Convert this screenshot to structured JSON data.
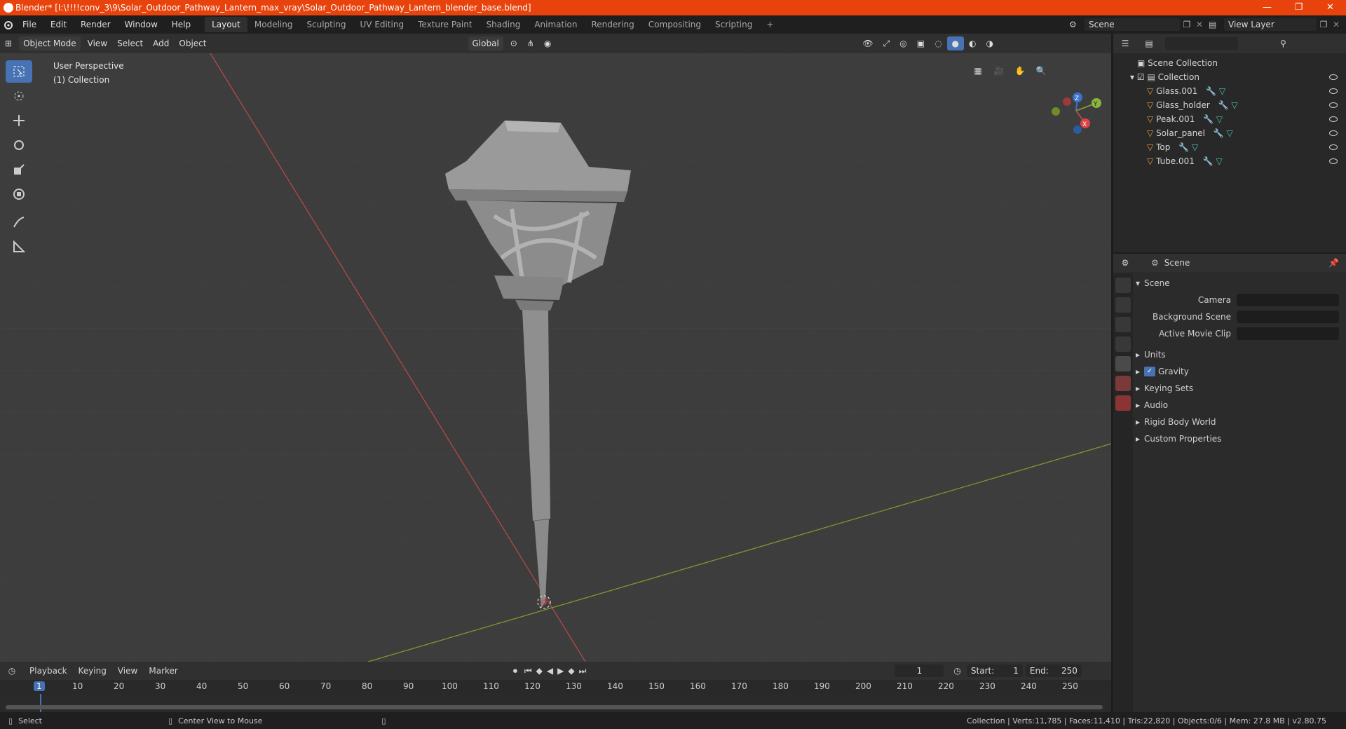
{
  "window": {
    "title": "Blender* [I:\\!!!!conv_3\\9\\Solar_Outdoor_Pathway_Lantern_max_vray\\Solar_Outdoor_Pathway_Lantern_blender_base.blend]",
    "minimize": "—",
    "maximize": "❐",
    "close": "✕"
  },
  "menu": [
    "File",
    "Edit",
    "Render",
    "Window",
    "Help"
  ],
  "workspaces": [
    "Layout",
    "Modeling",
    "Sculpting",
    "UV Editing",
    "Texture Paint",
    "Shading",
    "Animation",
    "Rendering",
    "Compositing",
    "Scripting",
    "+"
  ],
  "scene_field": "Scene",
  "view_layer_field": "View Layer",
  "viewport_header": {
    "mode": "Object Mode",
    "view": "View",
    "select": "Select",
    "add": "Add",
    "object": "Object",
    "orientation": "Global"
  },
  "viewport_info": {
    "perspective": "User Perspective",
    "collection": "(1) Collection"
  },
  "gizmo": {
    "x": "X",
    "y": "Y",
    "z": "Z"
  },
  "outliner": {
    "root": "Scene Collection",
    "collection": "Collection",
    "objects": [
      "Glass.001",
      "Glass_holder",
      "Peak.001",
      "Solar_panel",
      "Top",
      "Tube.001"
    ]
  },
  "properties": {
    "header": "Scene",
    "panel": "Scene",
    "fields": [
      {
        "label": "Camera"
      },
      {
        "label": "Background Scene"
      },
      {
        "label": "Active Movie Clip"
      }
    ],
    "sections": [
      "Units",
      "Gravity",
      "Keying Sets",
      "Audio",
      "Rigid Body World",
      "Custom Properties"
    ],
    "gravity_checked": true
  },
  "timeline": {
    "menus": [
      "Playback",
      "Keying",
      "View",
      "Marker"
    ],
    "current_frame": "1",
    "start_label": "Start:",
    "start": "1",
    "end_label": "End:",
    "end": "250",
    "ticks": [
      "1",
      "10",
      "20",
      "30",
      "40",
      "50",
      "60",
      "70",
      "80",
      "90",
      "100",
      "110",
      "120",
      "130",
      "140",
      "150",
      "160",
      "170",
      "180",
      "190",
      "200",
      "210",
      "220",
      "230",
      "240",
      "250"
    ]
  },
  "status": {
    "left": "Select",
    "middle": "Center View to Mouse",
    "right": "Collection | Verts:11,785 | Faces:11,410 | Tris:22,820 | Objects:0/6 | Mem: 27.8 MB | v2.80.75"
  },
  "colors": {
    "accent": "#4772b3",
    "titlebar": "#e8430c",
    "x_axis": "#b34848",
    "y_axis": "#7a9a2e",
    "z_axis": "#3a74c8"
  }
}
